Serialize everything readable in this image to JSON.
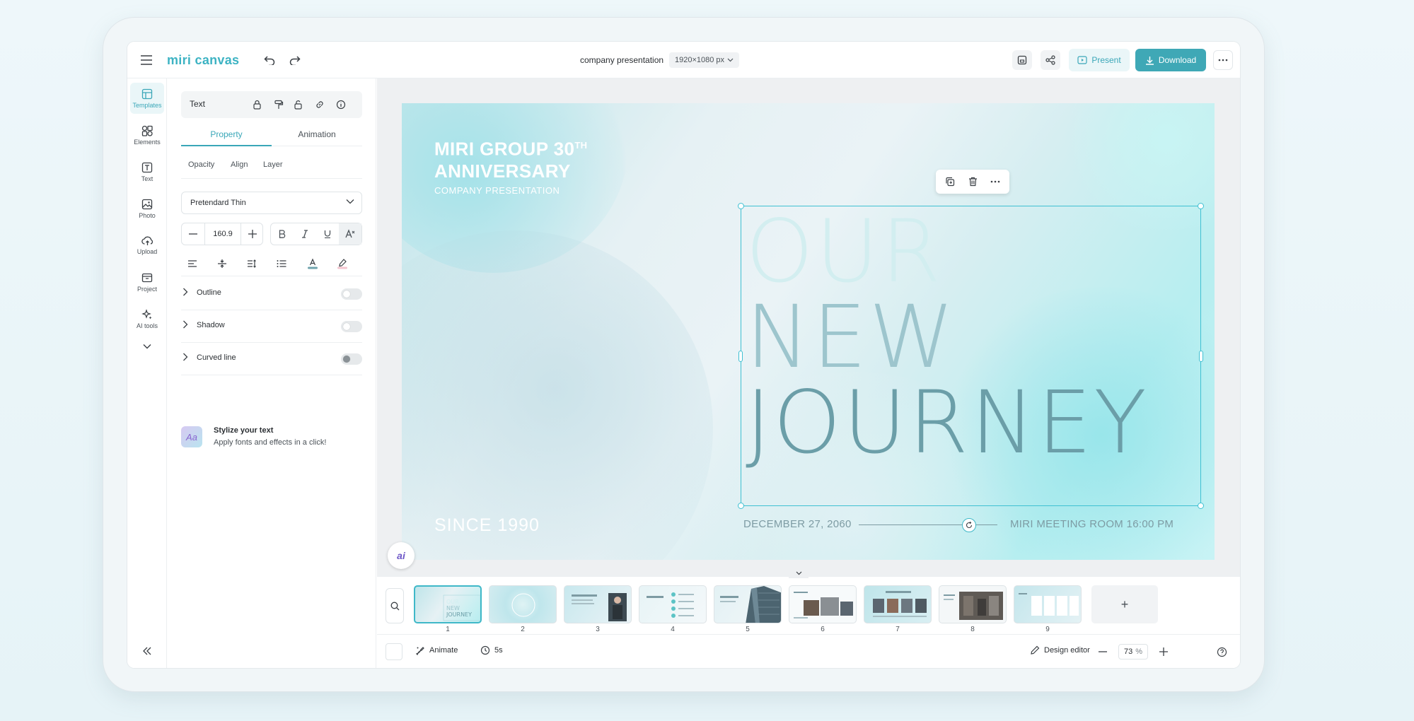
{
  "app": {
    "logo": "miri canvas",
    "doc_title": "company presentation",
    "doc_size": "1920×1080 px",
    "present_label": "Present",
    "download_label": "Download"
  },
  "rail": {
    "items": [
      {
        "label": "Templates",
        "icon": "templates-icon",
        "active": true
      },
      {
        "label": "Elements",
        "icon": "elements-icon"
      },
      {
        "label": "Text",
        "icon": "text-icon"
      },
      {
        "label": "Photo",
        "icon": "photo-icon"
      },
      {
        "label": "Upload",
        "icon": "upload-icon"
      },
      {
        "label": "Project",
        "icon": "project-icon"
      },
      {
        "label": "AI tools",
        "icon": "ai-tools-icon"
      }
    ]
  },
  "panel": {
    "header_title": "Text",
    "tabs": [
      "Property",
      "Animation"
    ],
    "subtabs": [
      "Opacity",
      "Align",
      "Layer"
    ],
    "font_family": "Pretendard Thin",
    "font_size": "160.9",
    "toggles": [
      {
        "label": "Outline",
        "on": false
      },
      {
        "label": "Shadow",
        "on": false
      },
      {
        "label": "Curved line",
        "on": false
      }
    ],
    "stylize_title": "Stylize your text",
    "stylize_desc": "Apply fonts and effects in a click!",
    "stylize_thumb": "Aa"
  },
  "slide": {
    "title_line1": "MIRI GROUP 30",
    "title_sup": "TH",
    "title_line2": "ANNIVERSARY",
    "subtitle": "COMPANY PRESENTATION",
    "big_line1": "OUR",
    "big_line2": "NEW",
    "big_line3": "JOURNEY",
    "since": "SINCE 1990",
    "date": "DECEMBER 27, 2060",
    "place": "MIRI MEETING ROOM 16:00 PM",
    "ai_label": "ai"
  },
  "pages": [
    "1",
    "2",
    "3",
    "4",
    "5",
    "6",
    "7",
    "8",
    "9"
  ],
  "bottom": {
    "animate_label": "Animate",
    "duration": "5s",
    "design_editor": "Design editor",
    "zoom": "73",
    "zoom_unit": "%",
    "add_page": "+"
  }
}
